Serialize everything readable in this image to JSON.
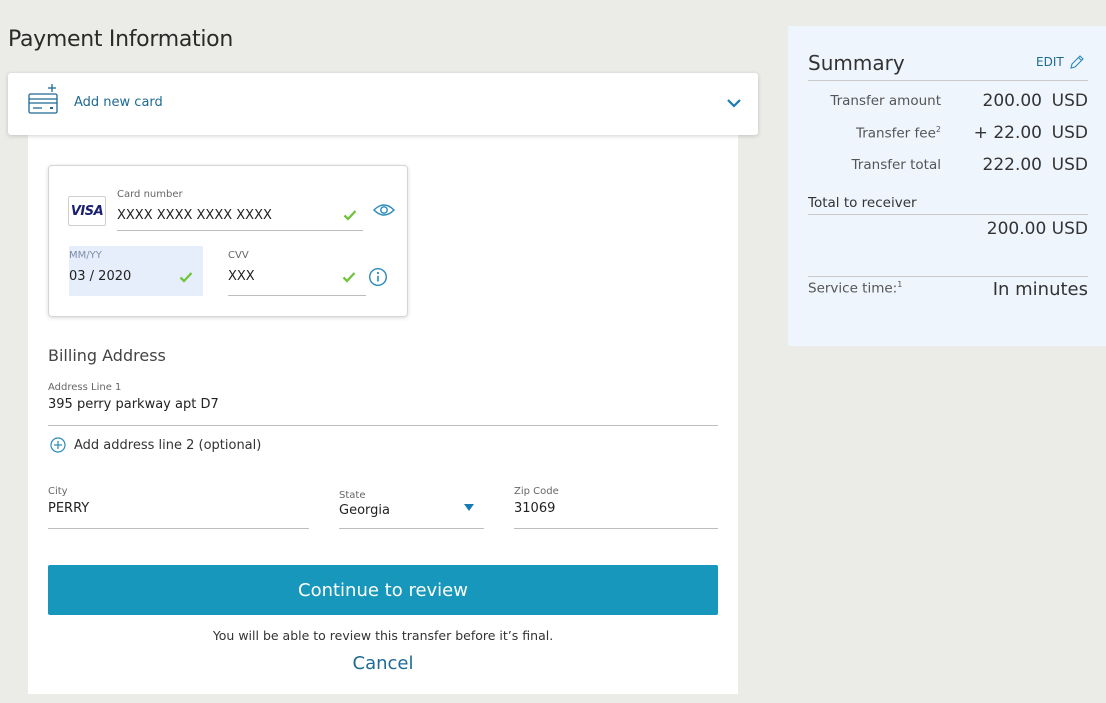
{
  "page": {
    "title": "Payment Information"
  },
  "card_selector": {
    "label": "Add new card"
  },
  "card_form": {
    "brand": "VISA",
    "card_number": {
      "label": "Card number",
      "value": "XXXX XXXX XXXX XXXX"
    },
    "expiry": {
      "label": "MM/YY",
      "value": "03 / 2020"
    },
    "cvv": {
      "label": "CVV",
      "value": "XXX"
    }
  },
  "billing": {
    "title": "Billing Address",
    "address_line_1": {
      "label": "Address Line 1",
      "value": "395 perry parkway apt D7"
    },
    "add_line_2_label": "Add address line 2 (optional)",
    "city": {
      "label": "City",
      "value": "PERRY"
    },
    "state": {
      "label": "State",
      "value": "Georgia"
    },
    "zip": {
      "label": "Zip Code",
      "value": "31069"
    }
  },
  "actions": {
    "continue_label": "Continue to review",
    "review_note": "You will be able to review this transfer before it’s final.",
    "cancel_label": "Cancel"
  },
  "summary": {
    "title": "Summary",
    "edit_label": "EDIT",
    "rows": [
      {
        "label": "Transfer amount",
        "sup": "",
        "amount": "200.00",
        "currency": "USD"
      },
      {
        "label": "Transfer fee",
        "sup": "2",
        "amount": "+ 22.00",
        "currency": "USD"
      },
      {
        "label": "Transfer total",
        "sup": "",
        "amount": "222.00",
        "currency": "USD"
      }
    ],
    "receiver_label": "Total to receiver",
    "receiver_amount": "200.00 USD",
    "service_label": "Service time:",
    "service_sup": "1",
    "service_value": "In minutes"
  },
  "colors": {
    "accent": "#1797bb",
    "link": "#1e6a92",
    "valid_check": "#6fc43a",
    "summary_bg": "#eef5fd",
    "page_bg": "#ebebe7"
  }
}
